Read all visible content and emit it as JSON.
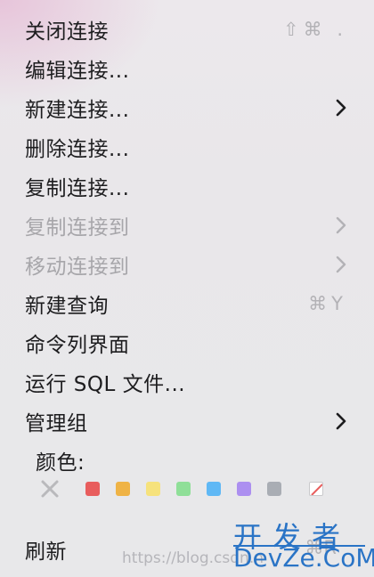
{
  "menu": {
    "items": [
      {
        "label": "关闭连接",
        "shortcut": "⇧⌘ .",
        "disabled": false
      },
      {
        "label": "编辑连接...",
        "disabled": false
      },
      {
        "label": "新建连接...",
        "disabled": false,
        "submenu": true
      },
      {
        "label": "删除连接...",
        "disabled": false
      },
      {
        "label": "复制连接...",
        "disabled": false
      },
      {
        "label": "复制连接到",
        "disabled": true,
        "submenu": true
      },
      {
        "label": "移动连接到",
        "disabled": true,
        "submenu": true
      },
      {
        "label": "新建查询",
        "shortcut": "⌘Y",
        "disabled": false
      },
      {
        "label": "命令列界面",
        "disabled": false
      },
      {
        "label": "运行 SQL 文件...",
        "disabled": false
      },
      {
        "label": "管理组",
        "disabled": false,
        "submenu": true
      }
    ],
    "color_label": "颜色:",
    "color_swatches": [
      {
        "name": "none",
        "color": "#b9b9bc"
      },
      {
        "name": "red",
        "color": "#e85d5d"
      },
      {
        "name": "orange",
        "color": "#efb346"
      },
      {
        "name": "yellow",
        "color": "#f6e27c"
      },
      {
        "name": "green",
        "color": "#8fdf98"
      },
      {
        "name": "blue",
        "color": "#5fb8f5"
      },
      {
        "name": "purple",
        "color": "#ac8ff0"
      },
      {
        "name": "gray",
        "color": "#a9adb4"
      },
      {
        "name": "custom",
        "color": "#e85d5d"
      }
    ],
    "refresh": {
      "label": "刷新",
      "shortcut": "⌘R"
    }
  },
  "watermark": {
    "url": "https://blog.csdn.n",
    "brand_top": "开发者",
    "brand_bottom": "DevZe.CoM",
    "color": "#2a74c6"
  }
}
